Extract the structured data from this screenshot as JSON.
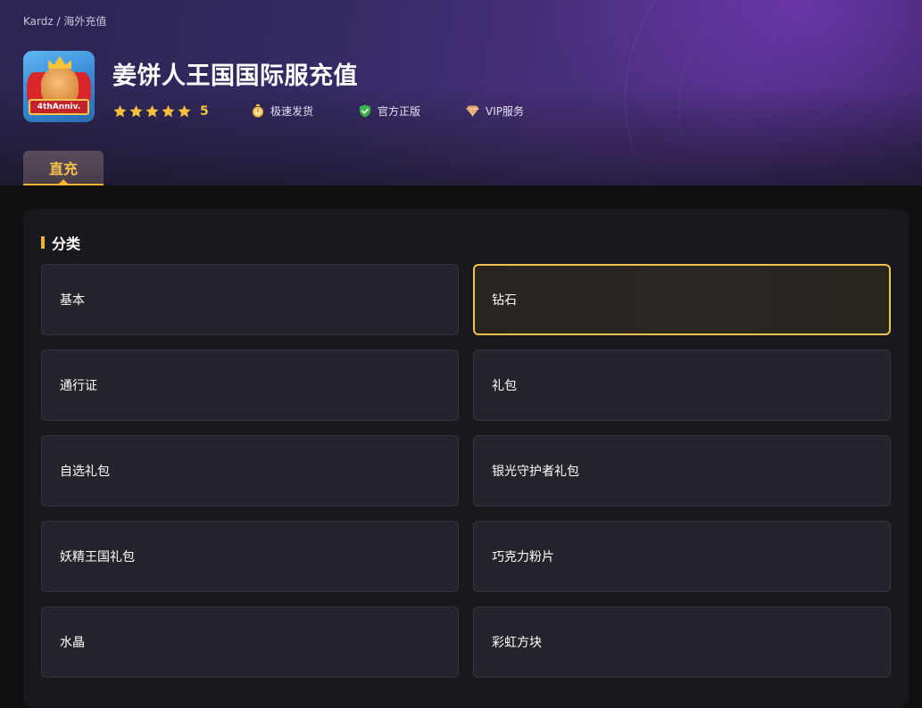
{
  "breadcrumb": {
    "root": "Kardz",
    "separator": " / ",
    "current": "海外充值"
  },
  "game": {
    "title": "姜饼人王国国际服充值",
    "icon_banner": "4thAnniv.",
    "rating_value": "5",
    "star_count": 5,
    "star_color": "#f5c13c"
  },
  "features": [
    {
      "icon": "stopwatch-icon",
      "label": "极速发货"
    },
    {
      "icon": "shield-check-icon",
      "label": "官方正版"
    },
    {
      "icon": "diamond-icon",
      "label": "VIP服务"
    }
  ],
  "tabs": [
    {
      "label": "直充",
      "active": true
    }
  ],
  "section": {
    "title": "分类"
  },
  "categories": [
    {
      "label": "基本",
      "selected": false
    },
    {
      "label": "钻石",
      "selected": true
    },
    {
      "label": "通行证",
      "selected": false
    },
    {
      "label": "礼包",
      "selected": false
    },
    {
      "label": "自选礼包",
      "selected": false
    },
    {
      "label": "银光守护者礼包",
      "selected": false
    },
    {
      "label": "妖精王国礼包",
      "selected": false
    },
    {
      "label": "巧克力粉片",
      "selected": false
    },
    {
      "label": "水晶",
      "selected": false
    },
    {
      "label": "彩虹方块",
      "selected": false
    }
  ],
  "colors": {
    "accent": "#f2b531",
    "background": "#0f1012",
    "card": "#23242c"
  }
}
